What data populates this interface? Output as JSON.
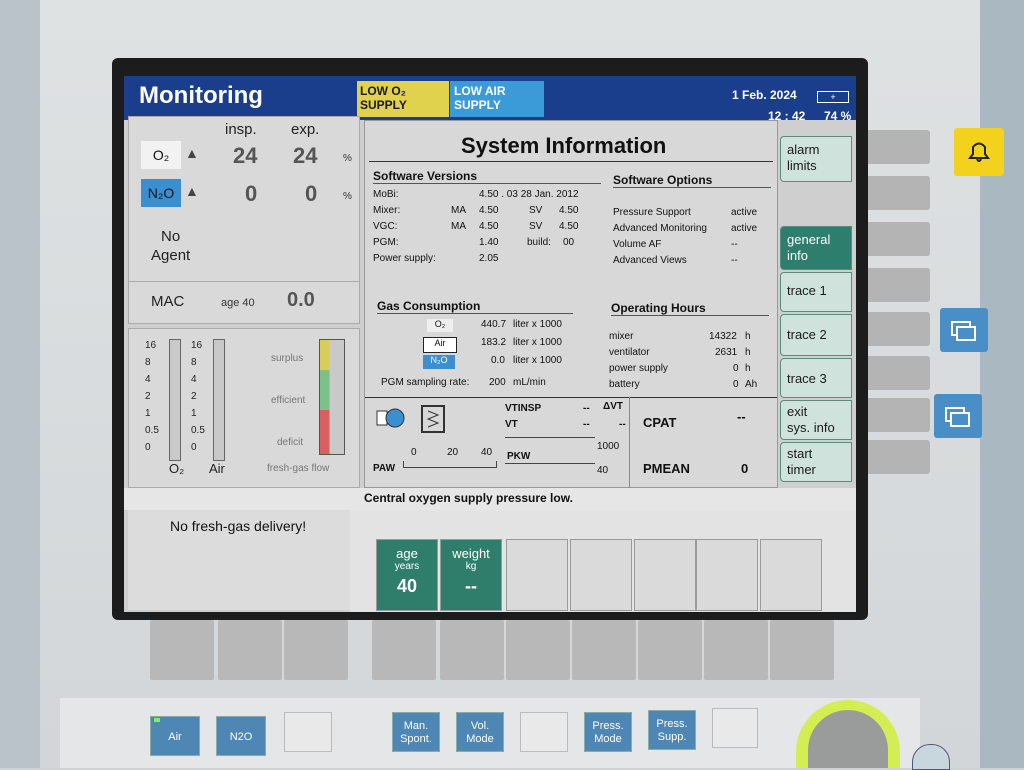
{
  "header": {
    "title": "Monitoring",
    "alarm_o2": [
      "LOW O₂",
      "SUPPLY"
    ],
    "alarm_air": [
      "LOW AIR",
      "SUPPLY"
    ],
    "date": "1 Feb. 2024",
    "time": "12 : 42",
    "battery": "74 %"
  },
  "gas": {
    "col_insp": "insp.",
    "col_exp": "exp.",
    "o2_label": "O₂",
    "o2_insp": "24",
    "o2_exp": "24",
    "o2_unit": "%",
    "n2o_label": "N₂O",
    "n2o_insp": "0",
    "n2o_exp": "0",
    "n2o_unit": "%",
    "agent": "No\nAgent",
    "mac_label": "MAC",
    "mac_age": "age 40",
    "mac_value": "0.0"
  },
  "flow": {
    "scale": [
      "16",
      "8",
      "4",
      "2",
      "1",
      "0.5",
      "0"
    ],
    "o2_label": "O₂",
    "air_label": "Air",
    "surplus": "surplus",
    "efficient": "efficient",
    "deficit": "deficit",
    "footer": "fresh-gas flow"
  },
  "system": {
    "title": "System Information",
    "software_versions": "Software Versions",
    "software_options": "Software Options",
    "mobi_label": "MoBi:",
    "mobi_value": "4.50 . 03  28  Jan.  2012",
    "mixer_label": "Mixer:",
    "mixer_ma": "MA",
    "mixer_ma_v": "4.50",
    "mixer_sv": "SV",
    "mixer_sv_v": "4.50",
    "vgc_label": "VGC:",
    "vgc_ma": "MA",
    "vgc_ma_v": "4.50",
    "vgc_sv": "SV",
    "vgc_sv_v": "4.50",
    "pgm_label": "PGM:",
    "pgm_v": "1.40",
    "pgm_build": "build:",
    "pgm_build_v": "00",
    "ps_label": "Power supply:",
    "ps_v": "2.05",
    "opt1": "Pressure Support",
    "opt1_v": "active",
    "opt2": "Advanced Monitoring",
    "opt2_v": "active",
    "opt3": "Volume AF",
    "opt3_v": "--",
    "opt4": "Advanced Views",
    "opt4_v": "--",
    "gas_consumption": "Gas Consumption",
    "gc_o2": "O₂",
    "gc_o2_v": "440.7",
    "gc_air": "Air",
    "gc_air_v": "183.2",
    "gc_n2o": "N₂O",
    "gc_n2o_v": "0.0",
    "gc_unit": "liter x 1000",
    "pgm_rate_label": "PGM sampling rate:",
    "pgm_rate_v": "200",
    "pgm_rate_unit": "mL/min",
    "operating_hours": "Operating Hours",
    "oh_mixer": "mixer",
    "oh_mixer_v": "14322",
    "oh_vent": "ventilator",
    "oh_vent_v": "2631",
    "oh_ps": "power supply",
    "oh_ps_v": "0",
    "oh_batt": "battery",
    "oh_batt_v": "0",
    "unit_h": "h",
    "unit_ah": "Ah"
  },
  "resp": {
    "vt_insp": "VTINSP",
    "vt": "VT",
    "dvt": "ΔVT",
    "vt_insp_v": "--",
    "vt_v": "--",
    "dvt_v": "--",
    "paw": "PAW",
    "paw_scale": [
      "0",
      "20",
      "40"
    ],
    "pkw": "PKW",
    "pkw_1000": "1000",
    "pkw_40": "40",
    "cpat": "CPAT",
    "cpat_v": "--",
    "pmean": "PMEAN",
    "pmean_v": "0"
  },
  "softkeys": [
    {
      "label": "alarm\nlimits"
    },
    {
      "label": "general\ninfo"
    },
    {
      "label": "trace 1"
    },
    {
      "label": "trace 2"
    },
    {
      "label": "trace 3"
    },
    {
      "label": "exit\nsys. info"
    },
    {
      "label": "start\ntimer"
    }
  ],
  "messages": {
    "central": "Central oxygen supply pressure low.",
    "fresh_gas": "No fresh-gas delivery!"
  },
  "patient": {
    "age_label": "age",
    "age_unit": "years",
    "age_value": "40",
    "weight_label": "weight",
    "weight_unit": "kg",
    "weight_value": "--"
  },
  "front_keys": {
    "air": "Air",
    "n2o": "N2O",
    "man_spont": "Man.\nSpont.",
    "vol_mode": "Vol.\nMode",
    "press_mode": "Press.\nMode",
    "press_supp": "Press.\nSupp."
  },
  "colors": {
    "header": "#1a3e8c",
    "alarm_yellow": "#e1d24e",
    "alarm_blue": "#3a9bd8",
    "softkey_active": "#2e7e6e"
  }
}
